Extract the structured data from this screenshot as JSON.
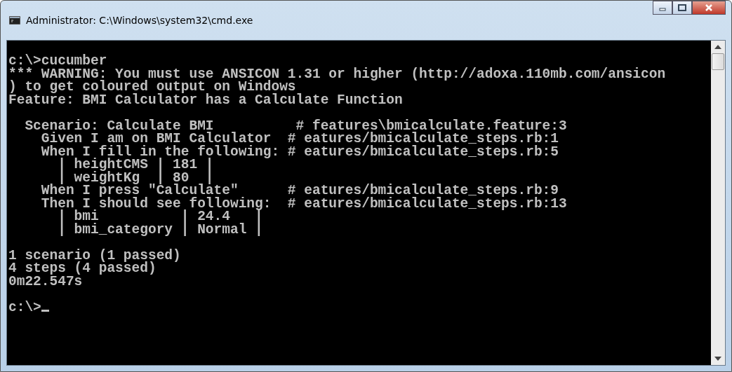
{
  "window": {
    "title": "Administrator: C:\\Windows\\system32\\cmd.exe"
  },
  "console": {
    "blocks": [
      [
        "c:\\>cucumber",
        "*** WARNING: You must use ANSICON 1.31 or higher (http://adoxa.110mb.com/ansicon",
        ") to get coloured output on Windows",
        "Feature: BMI Calculator has a Calculate Function"
      ],
      [
        "  Scenario: Calculate BMI          # features\\bmicalculate.feature:3",
        "    Given I am on BMI Calculator  # eatures/bmicalculate_steps.rb:1",
        "    When I fill in the following: # eatures/bmicalculate_steps.rb:5",
        "      | heightCMS | 181 |",
        "      | weightKg  | 80  |",
        "    When I press \"Calculate\"      # eatures/bmicalculate_steps.rb:9",
        "    Then I should see following:  # eatures/bmicalculate_steps.rb:13",
        "      | bmi          | 24.4   |",
        "      | bmi_category | Normal |"
      ],
      [
        "1 scenario (1 passed)",
        "4 steps (4 passed)",
        "0m22.547s"
      ]
    ],
    "prompt": "c:\\>"
  }
}
